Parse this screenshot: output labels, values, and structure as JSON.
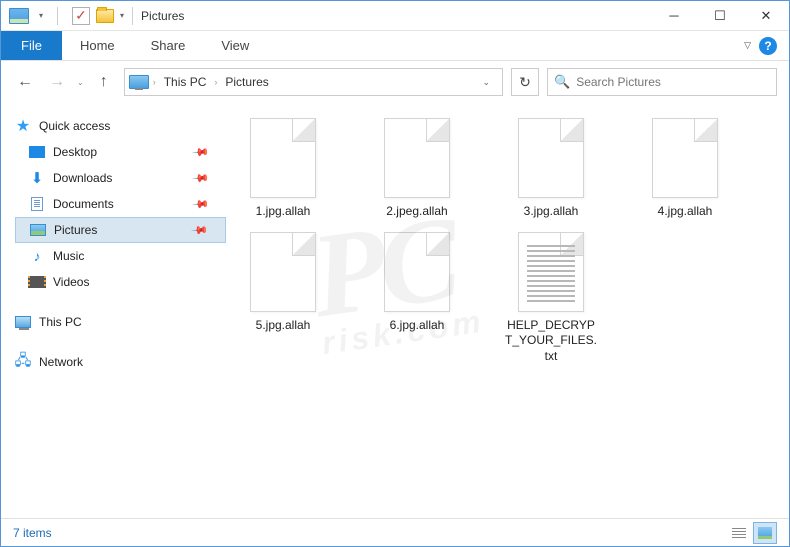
{
  "window": {
    "title": "Pictures"
  },
  "ribbon": {
    "file": "File",
    "tabs": [
      "Home",
      "Share",
      "View"
    ]
  },
  "breadcrumb": {
    "items": [
      "This PC",
      "Pictures"
    ]
  },
  "search": {
    "placeholder": "Search Pictures"
  },
  "sidebar": {
    "quick_access": {
      "label": "Quick access",
      "items": [
        {
          "label": "Desktop",
          "pinned": true,
          "icon": "desktop"
        },
        {
          "label": "Downloads",
          "pinned": true,
          "icon": "downloads"
        },
        {
          "label": "Documents",
          "pinned": true,
          "icon": "documents"
        },
        {
          "label": "Pictures",
          "pinned": true,
          "icon": "pictures",
          "selected": true
        },
        {
          "label": "Music",
          "pinned": false,
          "icon": "music"
        },
        {
          "label": "Videos",
          "pinned": false,
          "icon": "videos"
        }
      ]
    },
    "this_pc": {
      "label": "This PC"
    },
    "network": {
      "label": "Network"
    }
  },
  "files": [
    {
      "name": "1.jpg.allah",
      "type": "unknown"
    },
    {
      "name": "2.jpeg.allah",
      "type": "unknown"
    },
    {
      "name": "3.jpg.allah",
      "type": "unknown"
    },
    {
      "name": "4.jpg.allah",
      "type": "unknown"
    },
    {
      "name": "5.jpg.allah",
      "type": "unknown"
    },
    {
      "name": "6.jpg.allah",
      "type": "unknown"
    },
    {
      "name": "HELP_DECRYPT_YOUR_FILES.txt",
      "type": "txt"
    }
  ],
  "status": {
    "count_text": "7 items"
  }
}
